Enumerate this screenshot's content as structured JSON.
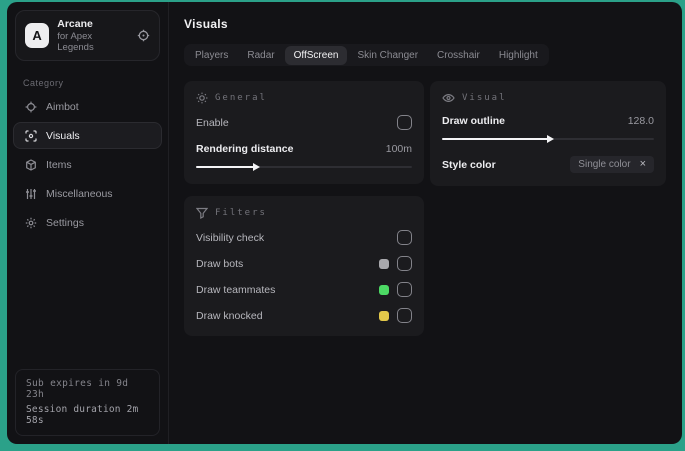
{
  "app": {
    "logo_letter": "A",
    "name": "Arcane",
    "subtitle": "for Apex Legends"
  },
  "sidebar": {
    "category_label": "Category",
    "items": [
      {
        "label": "Aimbot"
      },
      {
        "label": "Visuals"
      },
      {
        "label": "Items"
      },
      {
        "label": "Miscellaneous"
      },
      {
        "label": "Settings"
      }
    ],
    "footer": {
      "sub_expires": "Sub expires in 9d 23h",
      "session_duration": "Session duration 2m 58s"
    }
  },
  "header": {
    "title": "Visuals"
  },
  "tabs": [
    {
      "label": "Players",
      "active": false
    },
    {
      "label": "Radar",
      "active": false
    },
    {
      "label": "OffScreen",
      "active": true
    },
    {
      "label": "Skin Changer",
      "active": false
    },
    {
      "label": "Crosshair",
      "active": false
    },
    {
      "label": "Highlight",
      "active": false
    }
  ],
  "panels": {
    "general": {
      "title": "General",
      "enable_label": "Enable",
      "enable_checked": false,
      "rendering_distance_label": "Rendering distance",
      "rendering_distance_value": "100m",
      "slider_percent": 27
    },
    "visual": {
      "title": "Visual",
      "draw_outline_label": "Draw outline",
      "draw_outline_value": "128.0",
      "slider_percent": 50,
      "style_color_label": "Style color",
      "style_color_value": "Single color",
      "style_color_close": "×"
    },
    "filters": {
      "title": "Filters",
      "rows": [
        {
          "label": "Visibility check",
          "swatch": null,
          "checked": false
        },
        {
          "label": "Draw bots",
          "swatch": "#a9a9ad",
          "checked": false
        },
        {
          "label": "Draw teammates",
          "swatch": "#4cd964",
          "checked": false
        },
        {
          "label": "Draw knocked",
          "swatch": "#e2c84a",
          "checked": false
        }
      ]
    }
  },
  "colors": {
    "backdrop": "#2ba189",
    "window_bg": "#121215",
    "panel_bg": "#1b1b1e",
    "accent_text": "#ededf0",
    "muted_text": "#9a9aa1"
  }
}
